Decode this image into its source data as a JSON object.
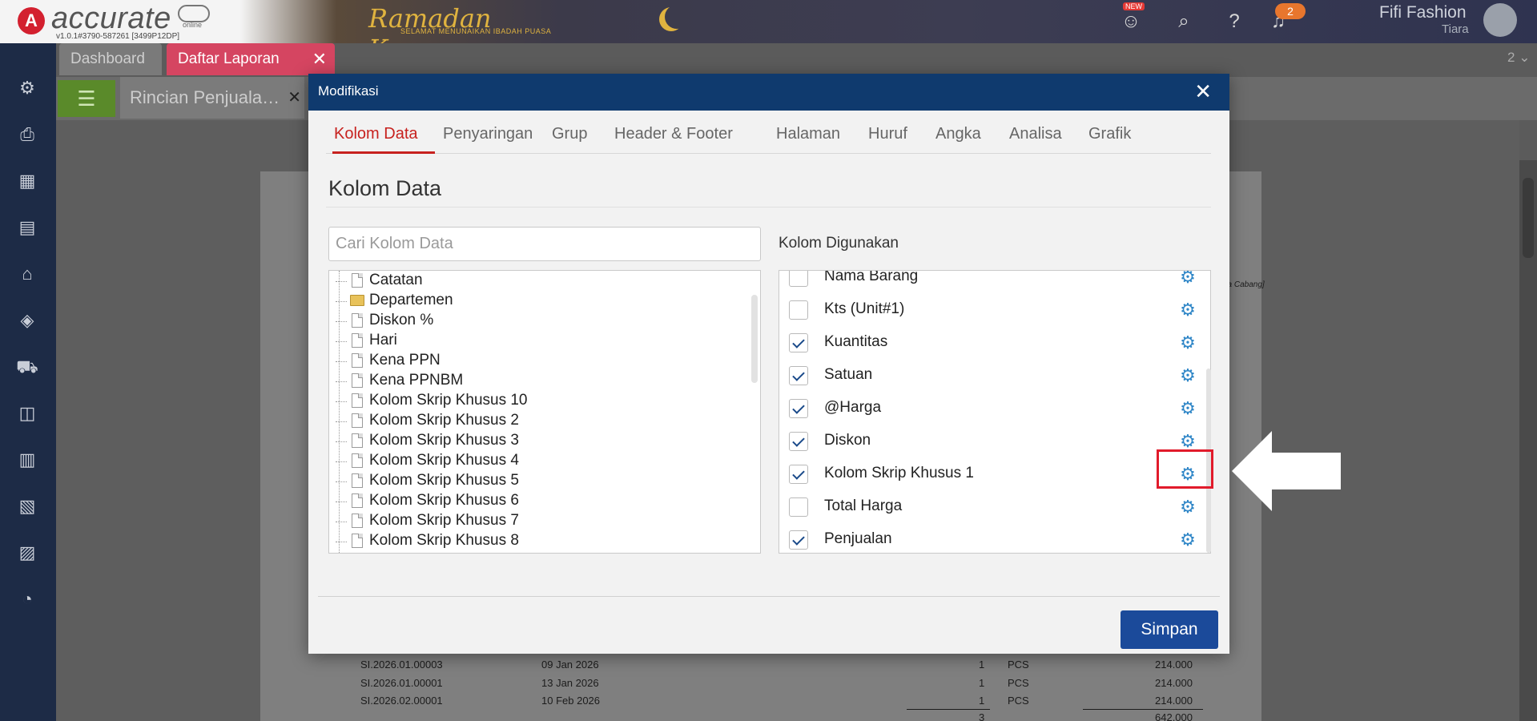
{
  "header": {
    "logo_mark": "A",
    "logo_text": "accurate",
    "logo_sub": "online",
    "version": "v1.0.1#3790-587261 [3499P12DP]",
    "banner_title": "Ramadan Kareem",
    "banner_sub": "SELAMAT MENUNAIKAN IBADAH PUASA",
    "new_badge": "NEW",
    "notification_count": "2",
    "company": "Fifi Fashion",
    "user": "Tiara"
  },
  "tabs": {
    "dashboard": "Dashboard",
    "laporan": "Daftar Laporan",
    "close": "✕",
    "window_count": "2"
  },
  "subtab": {
    "label": "Rincian Penjuala…",
    "close": "✕"
  },
  "report": {
    "cut_text": "ua Cabang]",
    "rows": [
      {
        "no": "SI.2026.01.00003",
        "date": "09 Jan 2026",
        "qty": "1",
        "unit": "PCS",
        "amount": "214.000"
      },
      {
        "no": "SI.2026.01.00001",
        "date": "13 Jan 2026",
        "qty": "1",
        "unit": "PCS",
        "amount": "214.000"
      },
      {
        "no": "SI.2026.02.00001",
        "date": "10 Feb 2026",
        "qty": "1",
        "unit": "PCS",
        "amount": "214.000"
      }
    ],
    "total_qty": "3",
    "total_amount": "642.000"
  },
  "modal": {
    "title": "Modifikasi",
    "close": "✕",
    "tabs": [
      "Kolom Data",
      "Penyaringan",
      "Grup",
      "Header & Footer",
      "Halaman",
      "Huruf",
      "Angka",
      "Analisa",
      "Grafik"
    ],
    "active_tab": "Kolom Data",
    "section_title": "Kolom Data",
    "search_placeholder": "Cari Kolom Data",
    "used_label": "Kolom Digunakan",
    "tree_items": [
      {
        "label": "Catatan",
        "type": "doc"
      },
      {
        "label": "Departemen",
        "type": "folder"
      },
      {
        "label": "Diskon %",
        "type": "doc"
      },
      {
        "label": "Hari",
        "type": "doc"
      },
      {
        "label": "Kena PPN",
        "type": "doc"
      },
      {
        "label": "Kena PPNBM",
        "type": "doc"
      },
      {
        "label": "Kolom Skrip Khusus 10",
        "type": "doc"
      },
      {
        "label": "Kolom Skrip Khusus 2",
        "type": "doc"
      },
      {
        "label": "Kolom Skrip Khusus 3",
        "type": "doc"
      },
      {
        "label": "Kolom Skrip Khusus 4",
        "type": "doc"
      },
      {
        "label": "Kolom Skrip Khusus 5",
        "type": "doc"
      },
      {
        "label": "Kolom Skrip Khusus 6",
        "type": "doc"
      },
      {
        "label": "Kolom Skrip Khusus 7",
        "type": "doc"
      },
      {
        "label": "Kolom Skrip Khusus 8",
        "type": "doc"
      }
    ],
    "used_columns": [
      {
        "label": "Nama Barang",
        "checked": false
      },
      {
        "label": "Kts (Unit#1)",
        "checked": false
      },
      {
        "label": "Kuantitas",
        "checked": true
      },
      {
        "label": "Satuan",
        "checked": true
      },
      {
        "label": "@Harga",
        "checked": true
      },
      {
        "label": "Diskon",
        "checked": true
      },
      {
        "label": "Kolom Skrip Khusus 1",
        "checked": true
      },
      {
        "label": "Total Harga",
        "checked": false
      },
      {
        "label": "Penjualan",
        "checked": true
      }
    ],
    "save_label": "Simpan"
  },
  "colors": {
    "header_bg": "#0f3a6e",
    "accent_red": "#c7221f",
    "gear_blue": "#2f86c7",
    "save_button": "#1b4a9a",
    "highlight_red": "#e11b2b",
    "sidebar_bg": "#1d2b46"
  }
}
